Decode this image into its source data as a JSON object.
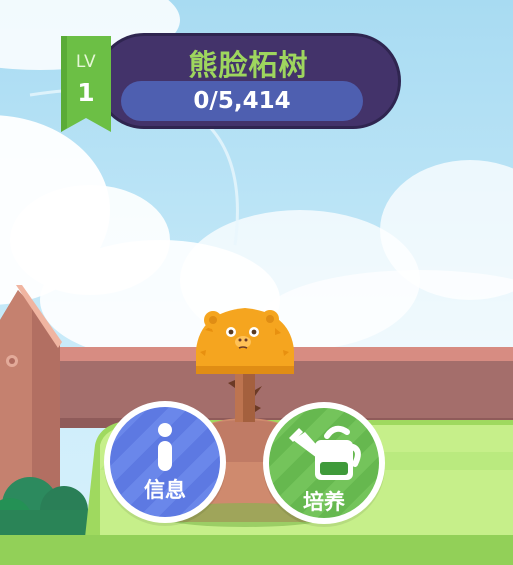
{
  "header": {
    "level_prefix": "LV",
    "level_number": "1",
    "plant_name": "熊脸柘树",
    "progress_text": "0/5,414",
    "progress_fraction": 0
  },
  "actions": {
    "info_label": "信息",
    "grow_label": "培养"
  },
  "colors": {
    "title_panel": "#43336a",
    "title_text": "#9ed65e",
    "progress_pill": "#4e5fb0",
    "level_ribbon": "#6cbf45",
    "info_button": "#5d79e2",
    "grow_button": "#66b84f",
    "sky": "#bfe6f7",
    "grass": "#b8e978",
    "fence": "#a36a66",
    "plant": "#f5a51f"
  },
  "icons": {
    "info": "info-icon",
    "grow": "watering-can-icon",
    "plant": "bear-face-plant-icon"
  }
}
